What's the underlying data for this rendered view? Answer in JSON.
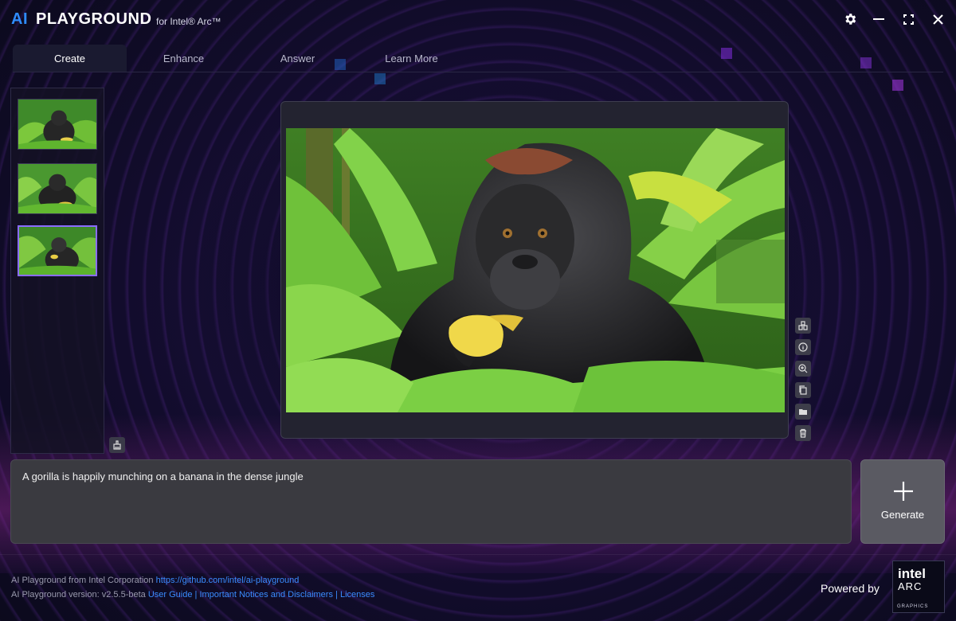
{
  "brand": {
    "ai": "AI",
    "playground": "PLAYGROUND",
    "subtitle": "for Intel® Arc™"
  },
  "window_icons": [
    "gear-icon",
    "minimize-icon",
    "maximize-icon",
    "close-icon"
  ],
  "tabs": [
    {
      "label": "Create",
      "active": true
    },
    {
      "label": "Enhance",
      "active": false
    },
    {
      "label": "Answer",
      "active": false
    },
    {
      "label": "Learn More",
      "active": false
    }
  ],
  "history": {
    "thumbnail_count": 3,
    "selected_index": 2
  },
  "preview": {
    "image_subject": "gorilla eating banana in jungle"
  },
  "side_tools": [
    "compare-icon",
    "info-icon",
    "zoom-in-icon",
    "copy-icon",
    "folder-icon",
    "trash-icon"
  ],
  "prompt": {
    "value": "A gorilla is happily munching on a banana in the dense jungle"
  },
  "generate": {
    "label": "Generate"
  },
  "footer": {
    "line1_text": "AI Playground from Intel Corporation ",
    "line1_link": "https://github.com/intel/ai-playground",
    "line2_text": "AI Playground version: v2.5.5-beta ",
    "user_guide": "User Guide",
    "sep": " | ",
    "notices": "Important Notices and Disclaimers",
    "licenses": "Licenses"
  },
  "powered_by": "Powered by",
  "badge": {
    "intel": "intel",
    "arc": "ARC",
    "graphics": "GRAPHICS"
  },
  "colors": {
    "accent": "#2f8cff",
    "link": "#3a8cff",
    "selection": "#8a6cff"
  }
}
